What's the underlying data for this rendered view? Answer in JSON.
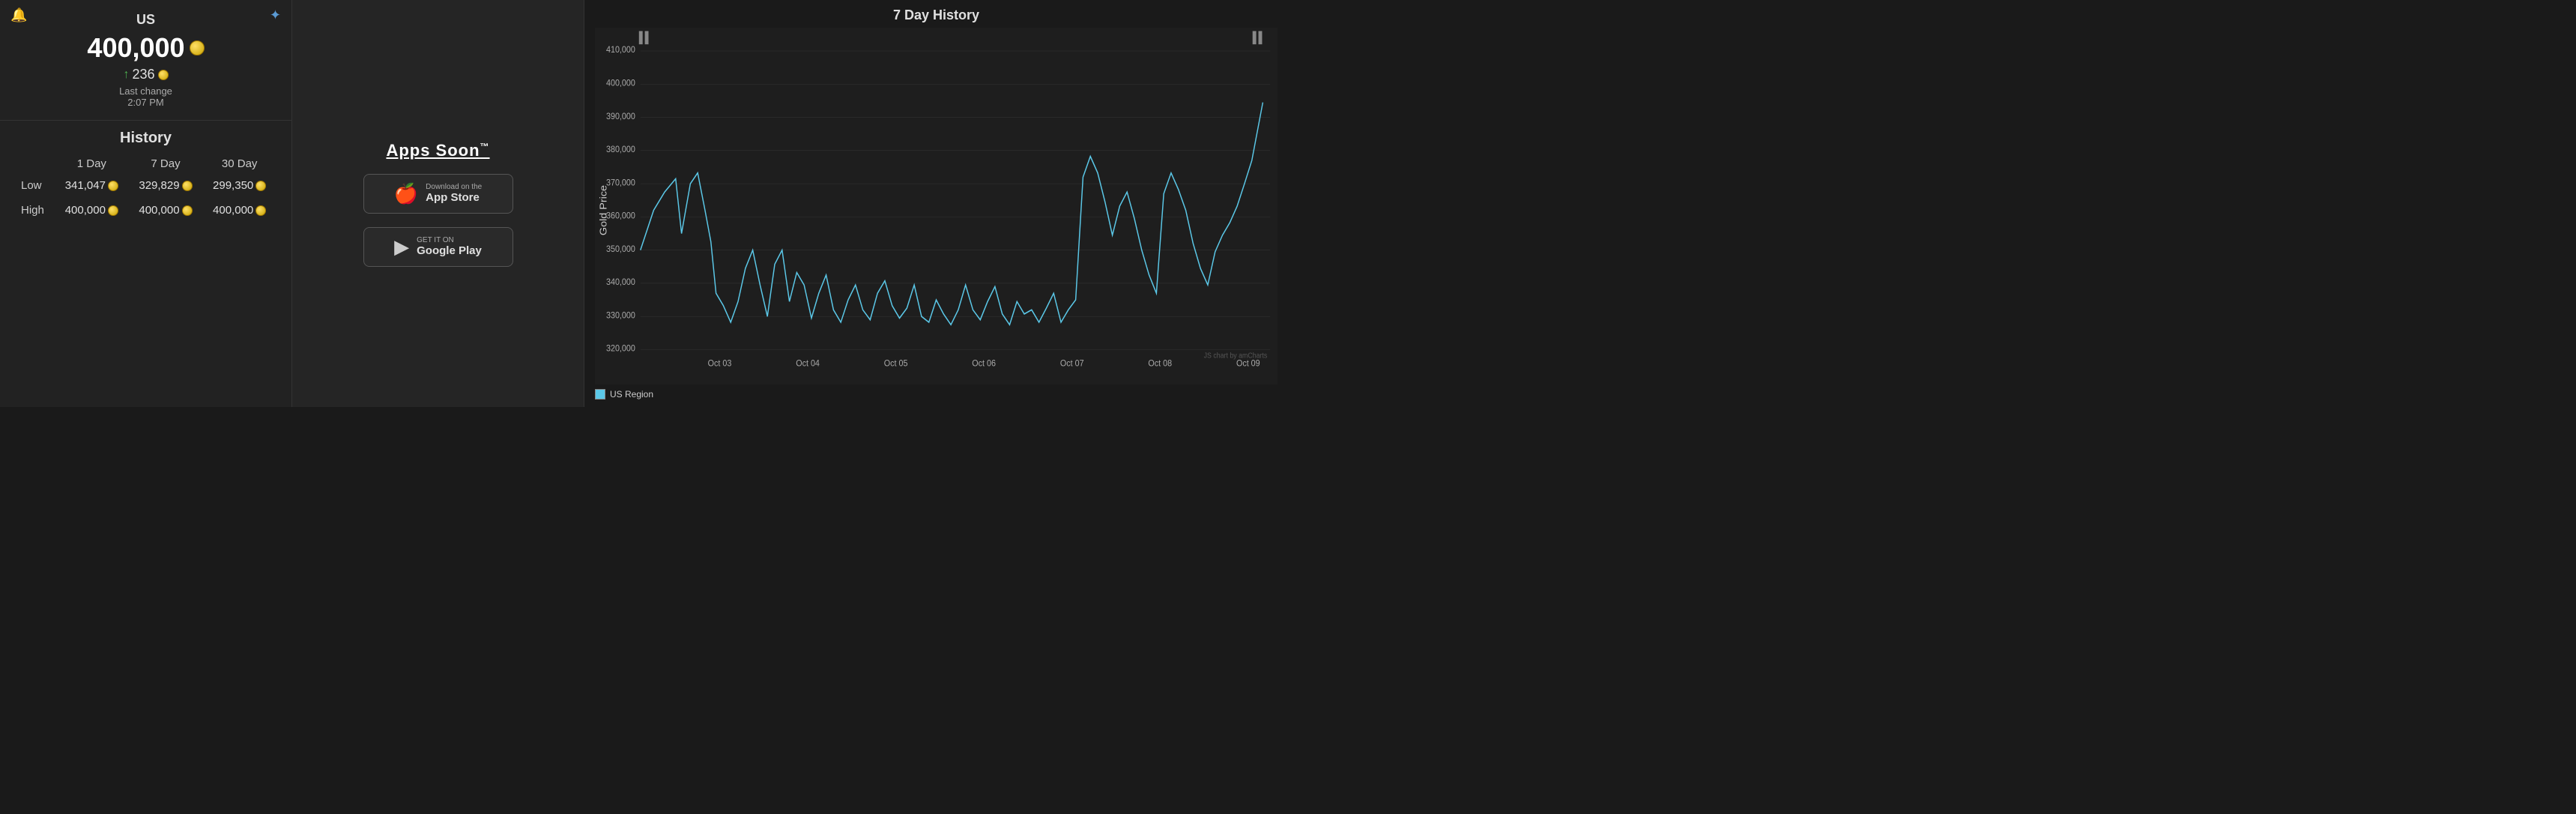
{
  "header": {
    "region": "US",
    "price": "400,000",
    "change": "236",
    "last_change_label": "Last change",
    "last_change_time": "2:07 PM"
  },
  "apps": {
    "title": "Apps Soon",
    "tm": "™",
    "appstore": {
      "sub": "Download on the",
      "main": "App Store"
    },
    "googleplay": {
      "sub": "GET IT ON",
      "main": "Google Play"
    }
  },
  "history": {
    "title": "History",
    "columns": [
      "",
      "1 Day",
      "7 Day",
      "30 Day"
    ],
    "rows": [
      {
        "label": "Low",
        "day1": "341,047",
        "day7": "329,829",
        "day30": "299,350"
      },
      {
        "label": "High",
        "day1": "400,000",
        "day7": "400,000",
        "day30": "400,000"
      }
    ]
  },
  "chart": {
    "title": "7 Day History",
    "y_axis_label": "Gold Price",
    "y_labels": [
      "410,000",
      "400,000",
      "390,000",
      "380,000",
      "370,000",
      "360,000",
      "350,000",
      "340,000",
      "330,000",
      "320,000"
    ],
    "x_labels": [
      "Oct 03",
      "Oct 04",
      "Oct 05",
      "Oct 06",
      "Oct 07",
      "Oct 08",
      "Oct 09"
    ],
    "legend": "US Region",
    "credit": "JS chart by amCharts"
  },
  "icons": {
    "bell": "🔔",
    "coin": "coin",
    "spark": "✦",
    "apple": "🍎",
    "play": "▶"
  }
}
